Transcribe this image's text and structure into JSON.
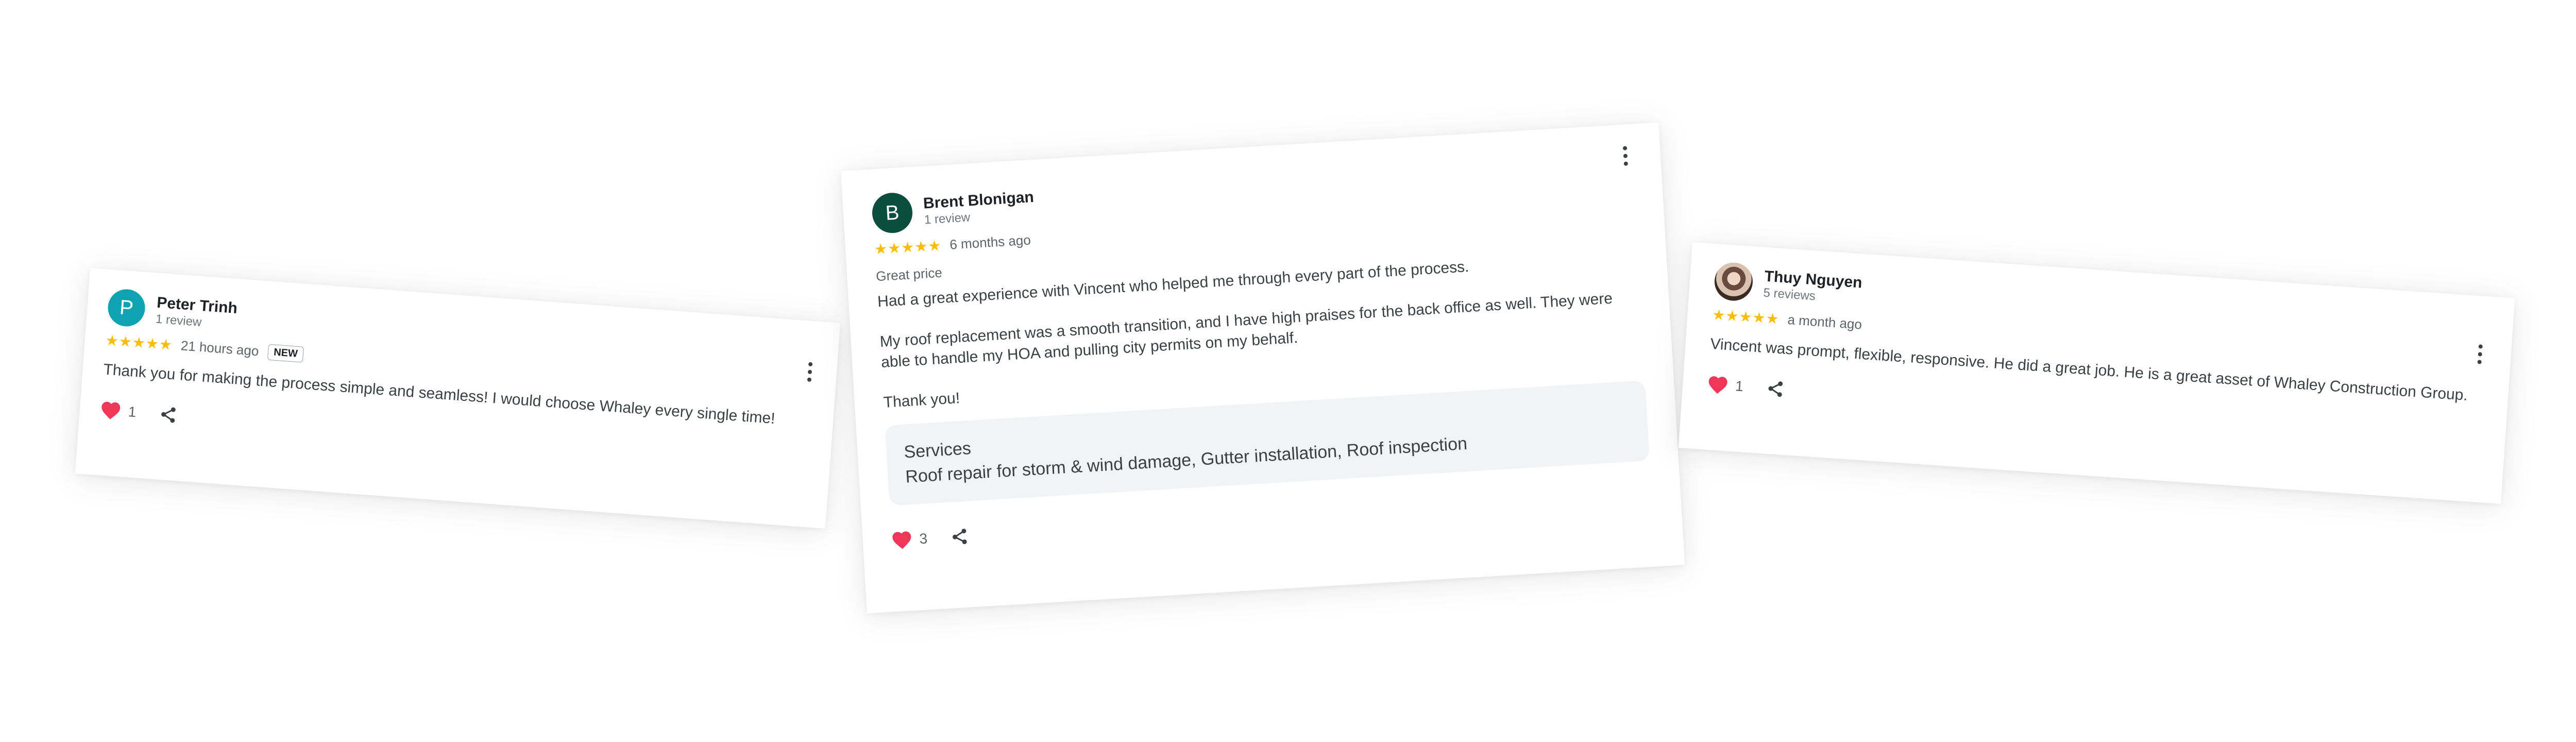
{
  "reviews": [
    {
      "avatar_letter": "P",
      "name": "Peter Trinh",
      "review_count": "1 review",
      "stars": "★★★★★",
      "time_ago": "21 hours ago",
      "badge": "NEW",
      "text": "Thank you for making the process simple and seamless! I would choose Whaley every single time!",
      "likes": "1"
    },
    {
      "avatar_letter": "B",
      "name": "Brent Blonigan",
      "review_count": "1 review",
      "stars": "★★★★★",
      "time_ago": "6 months ago",
      "tag": "Great price",
      "paragraphs": [
        "Had a great experience with Vincent who helped me through every part of the process.",
        "My roof replacement was a smooth transition, and I have high praises for the back office as well. They were able to handle my HOA and pulling city permits on my behalf.",
        "Thank you!"
      ],
      "services_label": "Services",
      "services_value": "Roof repair for storm & wind damage, Gutter installation, Roof inspection",
      "likes": "3"
    },
    {
      "name": "Thuy Nguyen",
      "review_count": "5 reviews",
      "stars": "★★★★★",
      "time_ago": "a month ago",
      "text": "Vincent was prompt, flexible, responsive. He did a great job. He is a great asset of Whaley Construction Group.",
      "likes": "1"
    }
  ],
  "colors": {
    "star": "#fbbc04",
    "heart": "#f0375a",
    "avatar_p": "#0fa3b1",
    "avatar_b": "#0b4d3e"
  },
  "icons": [
    "more-vert-icon",
    "heart-icon",
    "share-icon",
    "star-icon"
  ]
}
